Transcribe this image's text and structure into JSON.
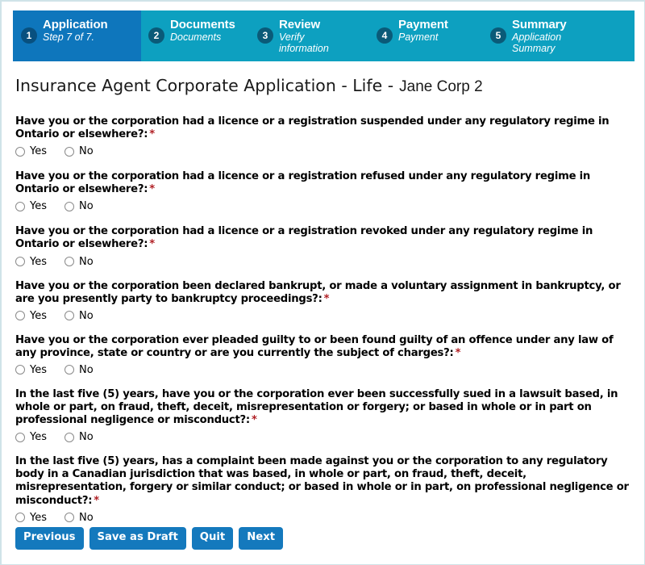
{
  "wizard": {
    "steps": [
      {
        "number": "1",
        "title": "Application",
        "subtitle": [
          "Step 7 of 7."
        ],
        "active": true
      },
      {
        "number": "2",
        "title": "Documents",
        "subtitle": [
          "Documents"
        ],
        "active": false
      },
      {
        "number": "3",
        "title": "Review",
        "subtitle": [
          "Verify",
          "information"
        ],
        "active": false
      },
      {
        "number": "4",
        "title": "Payment",
        "subtitle": [
          "Payment"
        ],
        "active": false
      },
      {
        "number": "5",
        "title": "Summary",
        "subtitle": [
          "Application",
          "Summary"
        ],
        "active": false
      }
    ],
    "active_color": "#0e76bc",
    "inactive_color": "#0da0c0"
  },
  "page": {
    "title": "Insurance Agent Corporate Application - Life -",
    "corporation_name": "Jane Corp 2"
  },
  "form": {
    "required_marker": "*",
    "yes_label": "Yes",
    "no_label": "No",
    "questions": [
      {
        "text": "Have you or the corporation had a licence or a registration suspended under any regulatory regime in Ontario or elsewhere?:",
        "required": true,
        "selected": null
      },
      {
        "text": "Have you or the corporation had a licence or a registration refused under any regulatory regime in Ontario or elsewhere?:",
        "required": true,
        "selected": null
      },
      {
        "text": "Have you or the corporation had a licence or a registration revoked under any regulatory regime in Ontario or elsewhere?:",
        "required": true,
        "selected": null
      },
      {
        "text": "Have you or the corporation been declared bankrupt, or made a voluntary assignment in bankruptcy, or are you presently party to bankruptcy proceedings?:",
        "required": true,
        "selected": null
      },
      {
        "text": "Have you or the corporation ever pleaded guilty to or been found guilty of an offence under any law of any province, state or country or are you currently the subject of charges?:",
        "required": true,
        "selected": null
      },
      {
        "text": "In the last five (5) years, have you or the corporation ever been successfully sued in a lawsuit based, in whole or part, on fraud, theft, deceit, misrepresentation or forgery; or based in whole or in part on professional negligence or misconduct?:",
        "required": true,
        "selected": null
      },
      {
        "text": "In the last five (5) years, has a complaint been made against you or the corporation to any regulatory body in a Canadian jurisdiction that was based, in whole or part, on fraud, theft, deceit, misrepresentation, forgery or similar conduct; or based in whole or in part, on professional negligence or misconduct?:",
        "required": true,
        "selected": null
      }
    ]
  },
  "buttons": {
    "previous": "Previous",
    "save_as_draft": "Save as Draft",
    "quit": "Quit",
    "next": "Next",
    "color": "#1479bd"
  }
}
